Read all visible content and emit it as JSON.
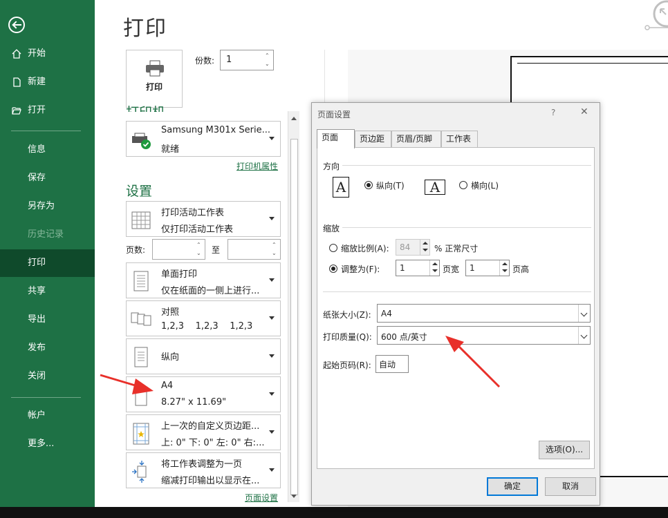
{
  "sidebar": {
    "items": [
      {
        "label": "开始",
        "icon": "home-icon"
      },
      {
        "label": "新建",
        "icon": "new-file-icon"
      },
      {
        "label": "打开",
        "icon": "folder-open-icon"
      },
      {
        "label": "信息"
      },
      {
        "label": "保存"
      },
      {
        "label": "另存为"
      },
      {
        "label": "历史记录"
      },
      {
        "label": "打印"
      },
      {
        "label": "共享"
      },
      {
        "label": "导出"
      },
      {
        "label": "发布"
      },
      {
        "label": "关闭"
      },
      {
        "label": "帐户"
      },
      {
        "label": "更多..."
      }
    ],
    "active": "打印",
    "disabled": "历史记录",
    "colors": {
      "bg": "#1e7145",
      "active_bg": "#0f4a2b"
    }
  },
  "print": {
    "title": "打印",
    "print_button": "打印",
    "copies_label": "份数:",
    "copies_value": "1"
  },
  "printer": {
    "heading": "打印机",
    "name": "Samsung M301x Serie...",
    "status": "就绪",
    "properties_link": "打印机属性"
  },
  "settings": {
    "heading": "设置",
    "scope": {
      "title": "打印活动工作表",
      "subtitle": "仅打印活动工作表"
    },
    "pages_label": "页数:",
    "to_label": "至",
    "sides": {
      "title": "单面打印",
      "subtitle": "仅在纸面的一侧上进行..."
    },
    "collate": {
      "title": "对照",
      "subtitle": "1,2,3    1,2,3    1,2,3"
    },
    "orientation": {
      "title": "纵向"
    },
    "paper": {
      "title": "A4",
      "subtitle": "8.27\" x 11.69\""
    },
    "margins": {
      "title": "上一次的自定义页边距...",
      "subtitle": "上: 0\" 下: 0\" 左: 0\" 右:..."
    },
    "scaling": {
      "title": "将工作表调整为一页",
      "subtitle": "缩减打印输出以显示在..."
    },
    "page_setup_link": "页面设置"
  },
  "dialog": {
    "title": "页面设置",
    "help": "?",
    "close": "✕",
    "tabs": [
      "页面",
      "页边距",
      "页眉/页脚",
      "工作表"
    ],
    "active_tab": "页面",
    "orientation": {
      "label": "方向",
      "portrait": "纵向(T)",
      "landscape": "横向(L)",
      "selected": "portrait",
      "icon_glyph": "A"
    },
    "scaling": {
      "label": "缩放",
      "adjust_label": "缩放比例(A):",
      "adjust_value": "84",
      "adjust_suffix": "% 正常尺寸",
      "fit_label": "调整为(F):",
      "fit_wide": "1",
      "fit_wide_suffix": "页宽",
      "fit_tall": "1",
      "fit_tall_suffix": "页高",
      "selected": "fit"
    },
    "paper_size": {
      "label": "纸张大小(Z):",
      "value": "A4"
    },
    "print_quality": {
      "label": "打印质量(Q):",
      "value": "600 点/英寸"
    },
    "first_page": {
      "label": "起始页码(R):",
      "value": "自动"
    },
    "options_button": "选项(O)...",
    "ok_button": "确定",
    "cancel_button": "取消"
  },
  "annotation_color": "#e8302a"
}
